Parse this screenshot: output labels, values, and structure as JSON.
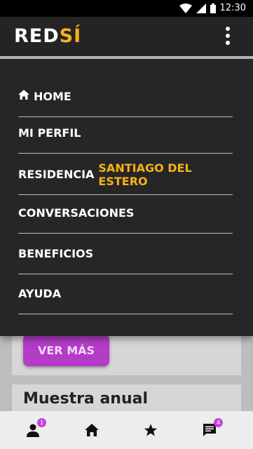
{
  "status_bar": {
    "time": "12:30"
  },
  "app_bar": {
    "logo_main": "RED",
    "logo_accent": "SÍ"
  },
  "background": {
    "button_label": "VER MÁS",
    "card_title": "Muestra anual"
  },
  "menu": {
    "items": [
      {
        "label": "HOME"
      },
      {
        "label": "MI PERFIL"
      },
      {
        "label": "RESIDENCIA",
        "highlight": "SANTIAGO DEL ESTERO"
      },
      {
        "label": "CONVERSACIONES"
      },
      {
        "label": "BENEFICIOS"
      },
      {
        "label": "AYUDA"
      }
    ]
  },
  "bottom_nav": {
    "profile_badge": "1",
    "chat_badge": "4"
  },
  "colors": {
    "accent": "#f5b21b",
    "button": "#b43cc8",
    "menu_bg": "#262626"
  }
}
